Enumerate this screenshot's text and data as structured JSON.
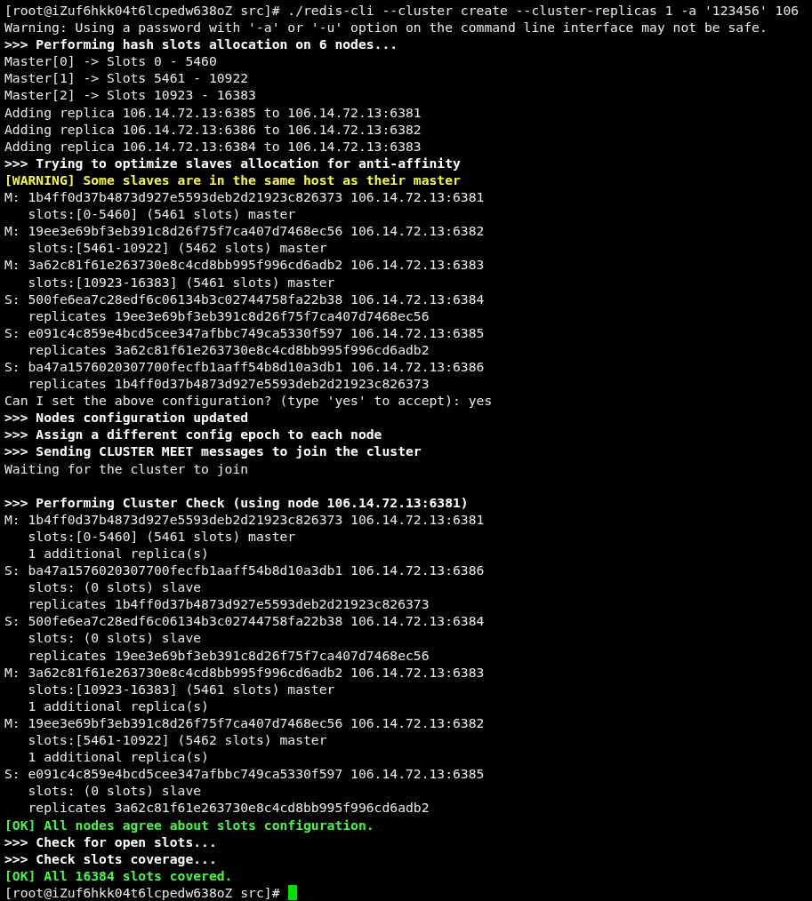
{
  "terminal": {
    "lines": [
      {
        "kind": "plain",
        "text": "[root@iZuf6hkk04t6lcpedw638oZ src]# ./redis-cli --cluster create --cluster-replicas 1 -a '123456' 106"
      },
      {
        "kind": "plain",
        "text": "Warning: Using a password with '-a' or '-u' option on the command line interface may not be safe."
      },
      {
        "kind": "bold",
        "text": ">>> Performing hash slots allocation on 6 nodes..."
      },
      {
        "kind": "plain",
        "text": "Master[0] -> Slots 0 - 5460"
      },
      {
        "kind": "plain",
        "text": "Master[1] -> Slots 5461 - 10922"
      },
      {
        "kind": "plain",
        "text": "Master[2] -> Slots 10923 - 16383"
      },
      {
        "kind": "plain",
        "text": "Adding replica 106.14.72.13:6385 to 106.14.72.13:6381"
      },
      {
        "kind": "plain",
        "text": "Adding replica 106.14.72.13:6386 to 106.14.72.13:6382"
      },
      {
        "kind": "plain",
        "text": "Adding replica 106.14.72.13:6384 to 106.14.72.13:6383"
      },
      {
        "kind": "bold",
        "text": ">>> Trying to optimize slaves allocation for anti-affinity"
      },
      {
        "kind": "warning",
        "text": "[WARNING] Some slaves are in the same host as their master"
      },
      {
        "kind": "plain",
        "text": "M: 1b4ff0d37b4873d927e5593deb2d21923c826373 106.14.72.13:6381"
      },
      {
        "kind": "plain",
        "text": "   slots:[0-5460] (5461 slots) master"
      },
      {
        "kind": "plain",
        "text": "M: 19ee3e69bf3eb391c8d26f75f7ca407d7468ec56 106.14.72.13:6382"
      },
      {
        "kind": "plain",
        "text": "   slots:[5461-10922] (5462 slots) master"
      },
      {
        "kind": "plain",
        "text": "M: 3a62c81f61e263730e8c4cd8bb995f996cd6adb2 106.14.72.13:6383"
      },
      {
        "kind": "plain",
        "text": "   slots:[10923-16383] (5461 slots) master"
      },
      {
        "kind": "plain",
        "text": "S: 500fe6ea7c28edf6c06134b3c02744758fa22b38 106.14.72.13:6384"
      },
      {
        "kind": "plain",
        "text": "   replicates 19ee3e69bf3eb391c8d26f75f7ca407d7468ec56"
      },
      {
        "kind": "plain",
        "text": "S: e091c4c859e4bcd5cee347afbbc749ca5330f597 106.14.72.13:6385"
      },
      {
        "kind": "plain",
        "text": "   replicates 3a62c81f61e263730e8c4cd8bb995f996cd6adb2"
      },
      {
        "kind": "plain",
        "text": "S: ba47a1576020307700fecfb1aaff54b8d10a3db1 106.14.72.13:6386"
      },
      {
        "kind": "plain",
        "text": "   replicates 1b4ff0d37b4873d927e5593deb2d21923c826373"
      },
      {
        "kind": "plain",
        "text": "Can I set the above configuration? (type 'yes' to accept): yes"
      },
      {
        "kind": "bold",
        "text": ">>> Nodes configuration updated"
      },
      {
        "kind": "bold",
        "text": ">>> Assign a different config epoch to each node"
      },
      {
        "kind": "bold",
        "text": ">>> Sending CLUSTER MEET messages to join the cluster"
      },
      {
        "kind": "plain",
        "text": "Waiting for the cluster to join"
      },
      {
        "kind": "blank"
      },
      {
        "kind": "bold",
        "text": ">>> Performing Cluster Check (using node 106.14.72.13:6381)"
      },
      {
        "kind": "plain",
        "text": "M: 1b4ff0d37b4873d927e5593deb2d21923c826373 106.14.72.13:6381"
      },
      {
        "kind": "plain",
        "text": "   slots:[0-5460] (5461 slots) master"
      },
      {
        "kind": "plain",
        "text": "   1 additional replica(s)"
      },
      {
        "kind": "plain",
        "text": "S: ba47a1576020307700fecfb1aaff54b8d10a3db1 106.14.72.13:6386"
      },
      {
        "kind": "plain",
        "text": "   slots: (0 slots) slave"
      },
      {
        "kind": "plain",
        "text": "   replicates 1b4ff0d37b4873d927e5593deb2d21923c826373"
      },
      {
        "kind": "plain",
        "text": "S: 500fe6ea7c28edf6c06134b3c02744758fa22b38 106.14.72.13:6384"
      },
      {
        "kind": "plain",
        "text": "   slots: (0 slots) slave"
      },
      {
        "kind": "plain",
        "text": "   replicates 19ee3e69bf3eb391c8d26f75f7ca407d7468ec56"
      },
      {
        "kind": "plain",
        "text": "M: 3a62c81f61e263730e8c4cd8bb995f996cd6adb2 106.14.72.13:6383"
      },
      {
        "kind": "plain",
        "text": "   slots:[10923-16383] (5461 slots) master"
      },
      {
        "kind": "plain",
        "text": "   1 additional replica(s)"
      },
      {
        "kind": "plain",
        "text": "M: 19ee3e69bf3eb391c8d26f75f7ca407d7468ec56 106.14.72.13:6382"
      },
      {
        "kind": "plain",
        "text": "   slots:[5461-10922] (5462 slots) master"
      },
      {
        "kind": "plain",
        "text": "   1 additional replica(s)"
      },
      {
        "kind": "plain",
        "text": "S: e091c4c859e4bcd5cee347afbbc749ca5330f597 106.14.72.13:6385"
      },
      {
        "kind": "plain",
        "text": "   slots: (0 slots) slave"
      },
      {
        "kind": "plain",
        "text": "   replicates 3a62c81f61e263730e8c4cd8bb995f996cd6adb2"
      },
      {
        "kind": "ok",
        "text": "[OK] All nodes agree about slots configuration."
      },
      {
        "kind": "bold",
        "text": ">>> Check for open slots..."
      },
      {
        "kind": "bold",
        "text": ">>> Check slots coverage..."
      },
      {
        "kind": "ok",
        "text": "[OK] All 16384 slots covered."
      },
      {
        "kind": "prompt",
        "text": "[root@iZuf6hkk04t6lcpedw638oZ src]#"
      }
    ]
  }
}
